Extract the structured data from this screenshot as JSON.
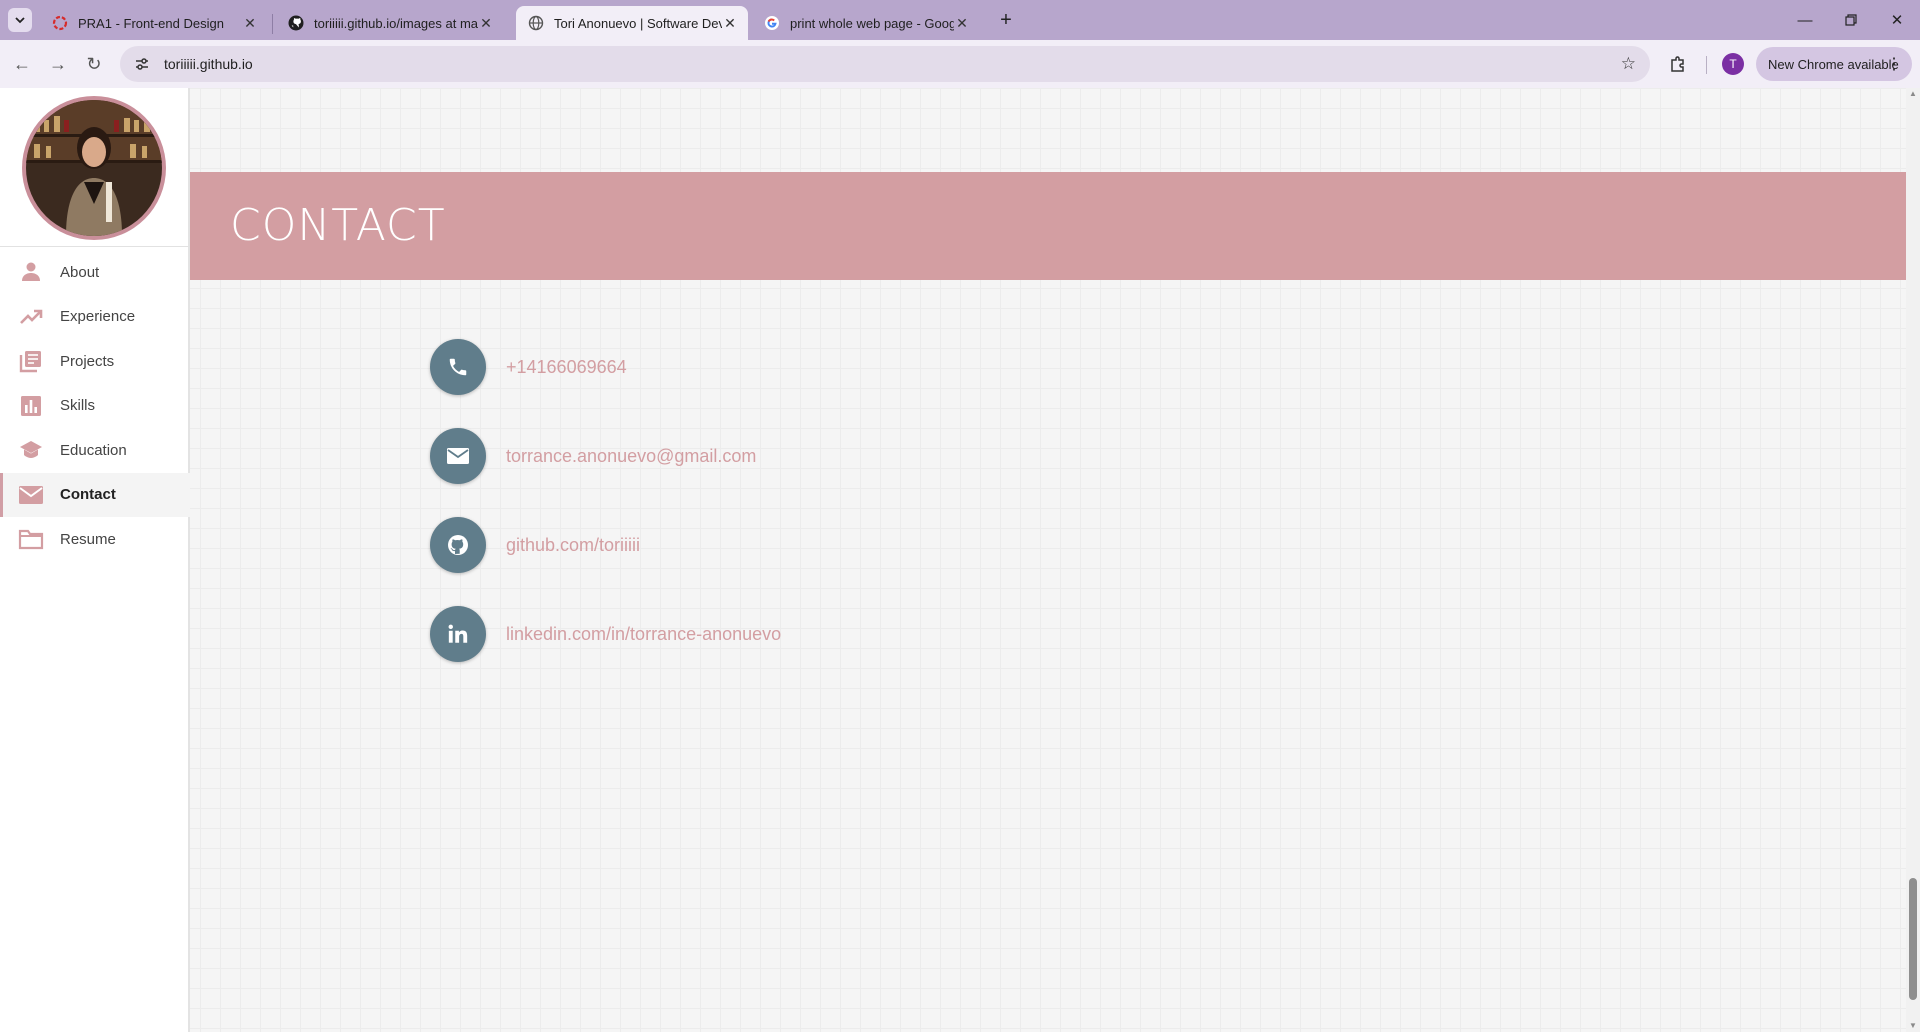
{
  "browser": {
    "tabs": [
      {
        "title": "PRA1 - Front-end Design",
        "active": false,
        "favicon": "circle-logo-icon"
      },
      {
        "title": "toriiiii.github.io/images at main",
        "active": false,
        "favicon": "github-icon"
      },
      {
        "title": "Tori Anonuevo | Software Devel",
        "active": true,
        "favicon": "globe-icon"
      },
      {
        "title": "print whole web page - Google",
        "active": false,
        "favicon": "google-icon"
      }
    ],
    "url": "toriiiii.github.io",
    "profile_initial": "T",
    "update_label": "New Chrome available",
    "accent_color": "#b7a6cc"
  },
  "sidebar": {
    "items": [
      {
        "label": "About",
        "icon": "person-icon",
        "active": false
      },
      {
        "label": "Experience",
        "icon": "trending-up-icon",
        "active": false
      },
      {
        "label": "Projects",
        "icon": "library-books-icon",
        "active": false
      },
      {
        "label": "Skills",
        "icon": "bar-chart-icon",
        "active": false
      },
      {
        "label": "Education",
        "icon": "school-icon",
        "active": false
      },
      {
        "label": "Contact",
        "icon": "mail-icon",
        "active": true
      },
      {
        "label": "Resume",
        "icon": "folder-icon",
        "active": false
      }
    ],
    "accent_color": "#d39ea2"
  },
  "section": {
    "title": "CONTACT",
    "banner_color": "#d39ea2"
  },
  "contacts": [
    {
      "text": "+14166069664",
      "icon": "phone-icon"
    },
    {
      "text": "torrance.anonuevo@gmail.com",
      "icon": "envelope-icon"
    },
    {
      "text": "github.com/toriiiii",
      "icon": "github-icon"
    },
    {
      "text": "linkedin.com/in/torrance-anonuevo",
      "icon": "linkedin-icon"
    }
  ],
  "icon_circle_color": "#607d8b"
}
